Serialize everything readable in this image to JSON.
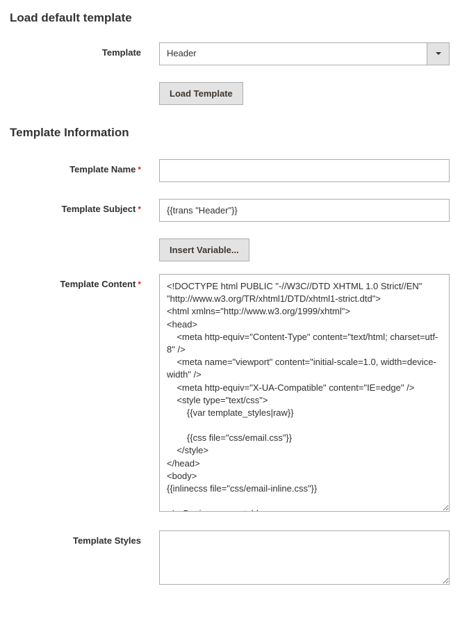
{
  "section1": {
    "title": "Load default template",
    "template_label": "Template",
    "template_value": "Header",
    "load_button": "Load Template"
  },
  "section2": {
    "title": "Template Information",
    "name_label": "Template Name",
    "name_value": "",
    "subject_label": "Template Subject",
    "subject_value": "{{trans \"Header\"}}",
    "insert_variable_button": "Insert Variable...",
    "content_label": "Template Content",
    "content_value": "<!DOCTYPE html PUBLIC \"-//W3C//DTD XHTML 1.0 Strict//EN\" \"http://www.w3.org/TR/xhtml1/DTD/xhtml1-strict.dtd\">\n<html xmlns=\"http://www.w3.org/1999/xhtml\">\n<head>\n    <meta http-equiv=\"Content-Type\" content=\"text/html; charset=utf-8\" />\n    <meta name=\"viewport\" content=\"initial-scale=1.0, width=device-width\" />\n    <meta http-equiv=\"X-UA-Compatible\" content=\"IE=edge\" />\n    <style type=\"text/css\">\n        {{var template_styles|raw}}\n\n        {{css file=\"css/email.css\"}}\n    </style>\n</head>\n<body>\n{{inlinecss file=\"css/email-inline.css\"}}\n\n<!-- Begin wrapper table -->",
    "styles_label": "Template Styles",
    "styles_value": ""
  }
}
